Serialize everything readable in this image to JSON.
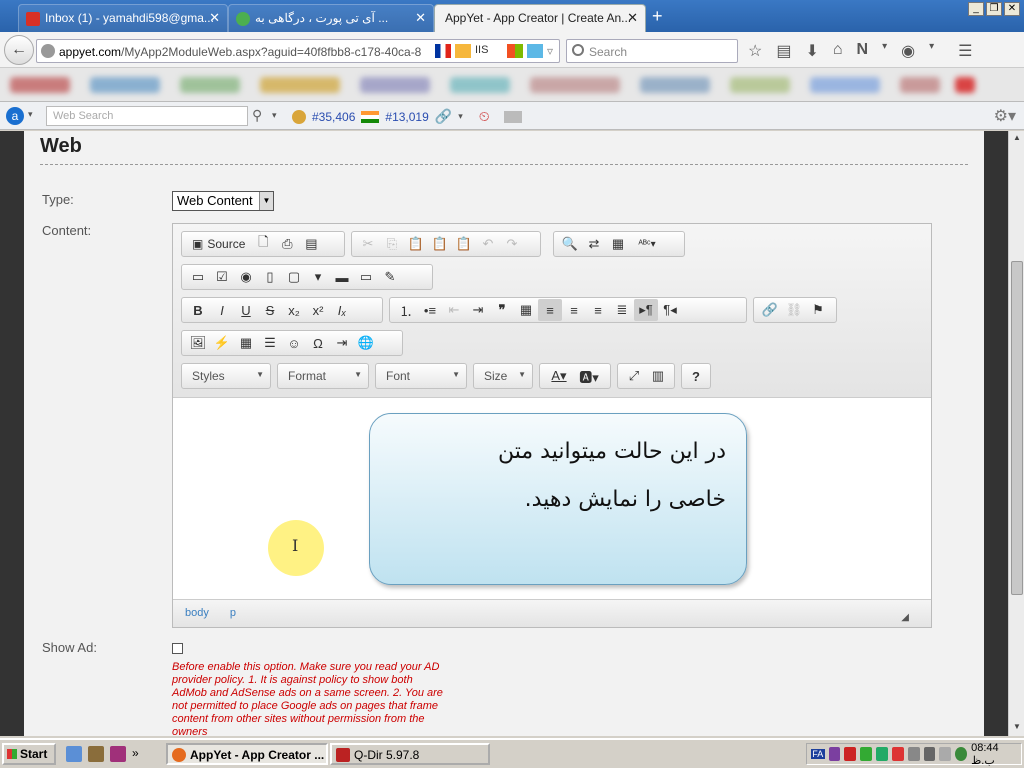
{
  "browser": {
    "tabs": [
      {
        "label": "Inbox (1) - yamahdi598@gma...",
        "active": false
      },
      {
        "label": "آی تی پورت ، درگاهی به ...",
        "active": false
      },
      {
        "label": "AppYet - App Creator | Create An...",
        "active": true
      }
    ],
    "url": "appyet.com/MyApp2ModuleWeb.aspx?aguid=40f8fbb8-c178-40ca-8",
    "url_domain": "appyet.com",
    "url_path": "/MyApp2ModuleWeb.aspx?aguid=40f8fbb8-c178-40ca-8",
    "search_placeholder": "Search"
  },
  "toolbar2": {
    "search_placeholder": "Web Search",
    "rank1": "#35,406",
    "rank2": "#13,019"
  },
  "page": {
    "title": "Web",
    "type_label": "Type:",
    "type_value": "Web Content",
    "content_label": "Content:",
    "show_ad_label": "Show Ad:",
    "show_ad_checked": false,
    "ad_warning": "Before enable this option. Make sure you read your AD provider policy. 1. It is against policy to show both AdMob and AdSense ads on a same screen. 2. You are not permitted to place Google ads on pages that frame content from other sites without permission from the owners"
  },
  "editor": {
    "source_label": "Source",
    "combos": {
      "styles": "Styles",
      "format": "Format",
      "font": "Font",
      "size": "Size"
    },
    "bubble_line1": "در این حالت میتوانید متن",
    "bubble_line2": "خاصی را نمایش دهید.",
    "path": [
      "body",
      "p"
    ]
  },
  "taskbar": {
    "start": "Start",
    "items": [
      {
        "label": "AppYet - App Creator ...",
        "active": true
      },
      {
        "label": "Q-Dir 5.97.8",
        "active": false
      }
    ],
    "lang": "FA",
    "clock": "08:44 ب.ظ"
  }
}
